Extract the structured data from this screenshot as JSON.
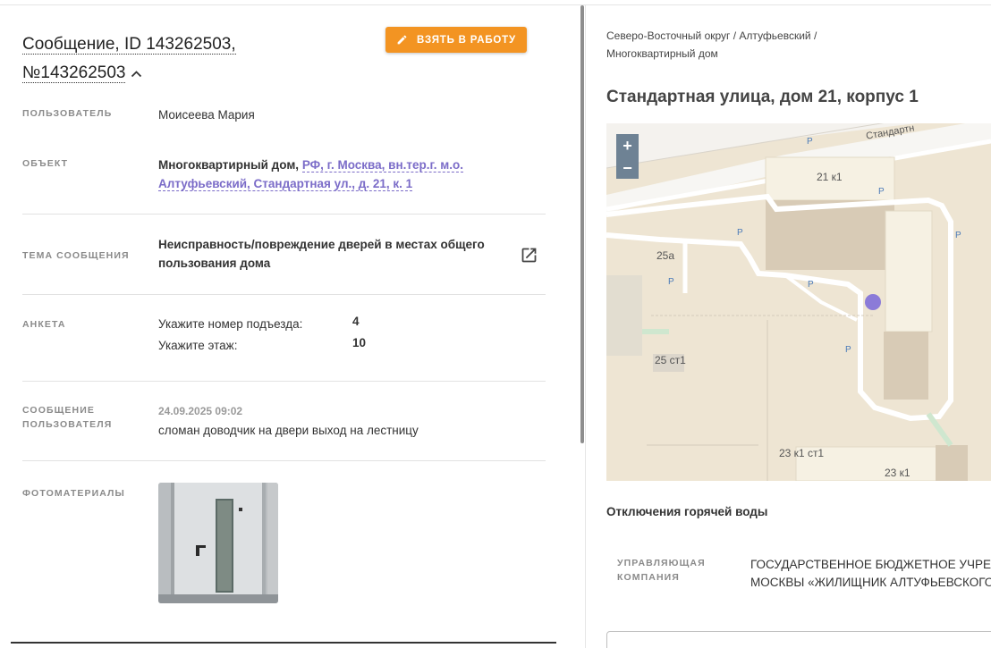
{
  "header": {
    "title_line1": "Сообщение, ID 143262503,",
    "title_line2": "№143262503",
    "take_button_label": "ВЗЯТЬ В РАБОТУ",
    "accent_color": "#f39422"
  },
  "fields": {
    "user_label": "ПОЛЬЗОВАТЕЛЬ",
    "user_value": "Моисеева Мария",
    "object_label": "ОБЪЕКТ",
    "object_type": "Многоквартирный дом,",
    "object_link_line1": "РФ, г. Москва, вн.тер.г. м.о.",
    "object_link_line2": "Алтуфьевский, Стандартная ул., д. 21, к. 1",
    "topic_label": "ТЕМА СООБЩЕНИЯ",
    "topic_line1": "Неисправность/повреждение дверей в местах общего",
    "topic_line2": "пользования дома",
    "survey_label": "АНКЕТА",
    "survey_items": [
      {
        "question": "Укажите номер подъезда:",
        "answer": "4"
      },
      {
        "question": "Укажите этаж:",
        "answer": "10"
      }
    ],
    "msg_label_line1": "СООБЩЕНИЕ",
    "msg_label_line2": "ПОЛЬЗОВАТЕЛЯ",
    "msg_date": "24.09.2025 09:02",
    "msg_text": "сломан доводчик на двери выход на лестницу",
    "photos_label": "ФОТОМАТЕРИАЛЫ"
  },
  "right": {
    "breadcrumb_line1": "Северо-Восточный округ / Алтуфьевский /",
    "breadcrumb_line2": "Многоквартирный дом",
    "address": "Стандартная улица, дом 21, корпус 1",
    "map": {
      "zoom_in": "+",
      "zoom_out": "−",
      "street_label": "Стандартн",
      "building_labels": [
        "21 к1",
        "25а",
        "25 ст1",
        "23 к1 ст1",
        "23 к1"
      ],
      "parking_label": "P",
      "marker_color": "#8b7bd8"
    },
    "hot_water_title": "Отключения горячей воды",
    "mc_label_line1": "УПРАВЛЯЮЩАЯ",
    "mc_label_line2": "КОМПАНИЯ",
    "mc_value_line1": "ГОСУДАРСТВЕННОЕ БЮДЖЕТНОЕ УЧРЕЖ",
    "mc_value_line2": "МОСКВЫ «ЖИЛИЩНИК АЛТУФЬЕВСКОГО"
  }
}
